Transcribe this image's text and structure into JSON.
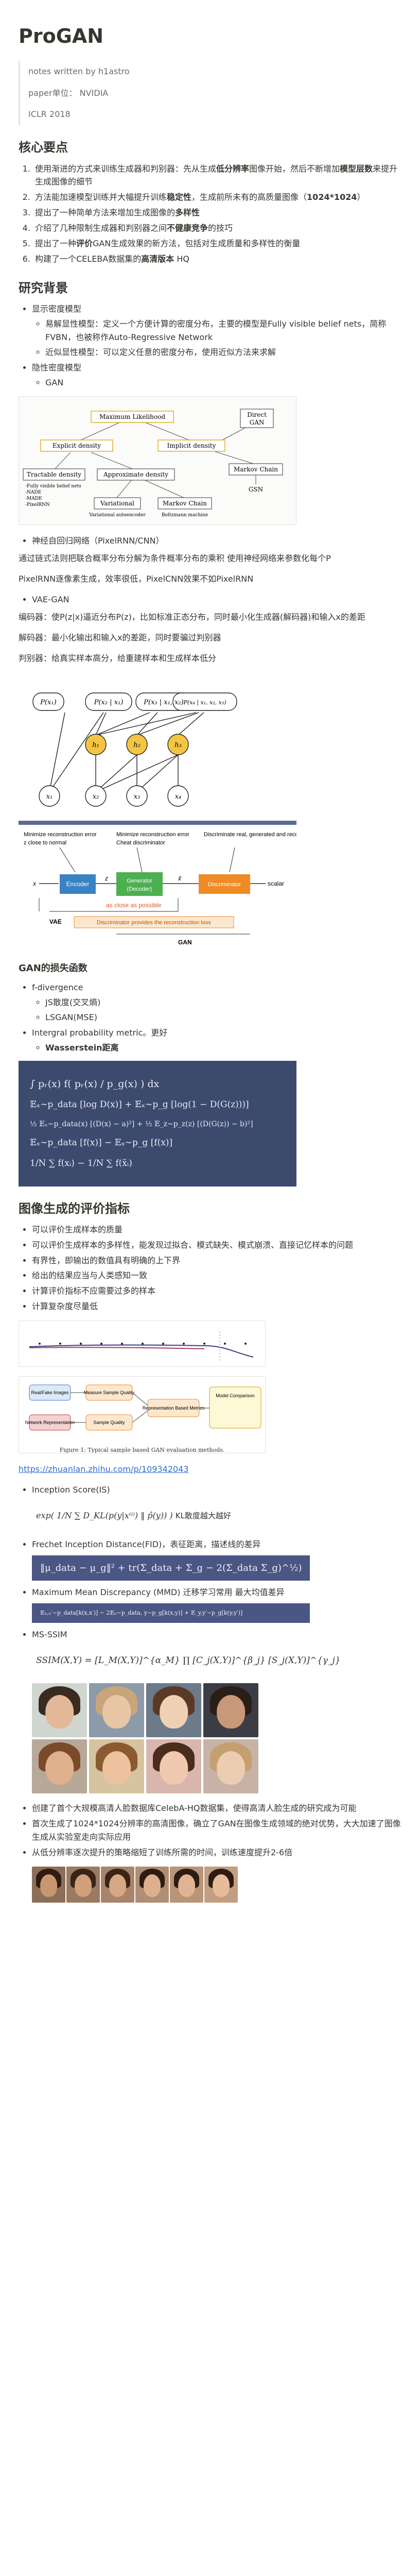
{
  "title": "ProGAN",
  "meta": {
    "notes": "notes written by h1astro",
    "paper_unit": "paper单位： NVIDIA",
    "venue": "ICLR 2018"
  },
  "key_points": {
    "heading": "核心要点",
    "items": [
      {
        "a": "使用渐进的方式来训练生成器和判别器：先从生成",
        "b": "低分辨率",
        "c": "图像开始，然后不断增加",
        "d": "模型层数",
        "e": "来提升生成图像的细节"
      },
      {
        "a": "方法能加速模型训练并大幅提升训练",
        "b": "稳定性",
        "c": "，生成前所未有的高质量图像（",
        "d": "1024*1024",
        "e": "）"
      },
      {
        "a": "提出了一种简单方法来增加生成图像的",
        "b": "多样性"
      },
      {
        "a": "介绍了几种限制生成器和判别器之间",
        "b": "不健康竞争",
        "c": "的技巧"
      },
      {
        "a": "提出了一种",
        "b": "评价",
        "c": "GAN生成效果的新方法，包括对生成质量和多样性的衡量"
      },
      {
        "a": "构建了一个CELEBA数据集的",
        "b": "高清版本",
        "c": " HQ"
      }
    ]
  },
  "background": {
    "heading": "研究背景",
    "explicit": "显示密度模型",
    "explicit_items": [
      "易解显性模型：定义一个方便计算的密度分布，主要的模型是Fully visible belief nets，简称FVBN，也被称作Auto-Regressive Network",
      "近似显性模型：可以定义任意的密度分布，使用近似方法来求解"
    ],
    "implicit": "隐性密度模型",
    "implicit_items": [
      "GAN"
    ],
    "taxonomy": {
      "root": "Maximum Likelihood",
      "explicit": "Explicit density",
      "implicit": "Implicit density",
      "direct": "Direct",
      "gan": "GAN",
      "tractable": "Tractable density",
      "tractable_sub": "-Fully visible belief nets\n-NADE\n-MADE\n-PixelRNN\n-Change of variables models\n(nonlinear ICA)",
      "approx": "Approximate density",
      "markov_implicit": "Markov Chain",
      "gsn": "GSN",
      "variational": "Variational",
      "vae": "Variational autoencoder",
      "markov_explicit": "Markov Chain",
      "boltzmann": "Boltzmann machine"
    },
    "pixelrnn_bullet": "神经自回归网络（PixelRNN/CNN）",
    "pixelrnn_p1": "通过链式法则把联合概率分布分解为条件概率分布的乘积 使用神经网络来参数化每个P",
    "pixelrnn_p2": "PixelRNN逐像素生成，效率很低，PixelCNN效果不如PixelRNN",
    "vae_bullet": "VAE-GAN",
    "vae_p1": "编码器：使P(z|x)逼近分布P(z)，比如标准正态分布，同时最小化生成器(解码器)和输入x的差距",
    "vae_p2": "解码器：最小化输出和输入x的差距，同时要骗过判别器",
    "vae_p3": "判别器：给真实样本高分，给重建样本和生成样本低分",
    "graph_nodes": {
      "p1": "P(x₁)",
      "p2": "P(x₂ | x₁)",
      "p3": "P(x₃ | x₁, x₂)",
      "p4": "P(x₄ | x₁, x₂, x₃)",
      "h1": "h₁",
      "h2": "h₂",
      "h3": "h₃",
      "x1": "x₁",
      "x2": "x₂",
      "x3": "x₃",
      "x4": "x₄"
    },
    "vaegan": {
      "c1": "Minimize reconstruction error",
      "c1b": "z close to normal",
      "c2": "Minimize reconstruction error",
      "c2b": "Cheat discriminator",
      "c3": "Discriminate real, generated and reconstructed images",
      "x": "x",
      "encoder": "Encoder",
      "z": "z",
      "generator": "Generator (Decoder)",
      "xtilde": "x̃",
      "discriminator": "Discriminator",
      "scalar": "scalar",
      "close": "as close as possible",
      "vae": "VAE",
      "gan": "GAN",
      "note": "Discriminator provides the reconstruction loss"
    }
  },
  "loss": {
    "heading": "GAN的损失函数",
    "fdiv": "f-divergence",
    "fdiv_items": [
      "JS散度(交叉熵)",
      "LSGAN(MSE)"
    ],
    "ipm": "Intergral probability metric。更好",
    "wass": "Wasserstein距离",
    "formulas": [
      "∫ pᵣ(x) f( pᵣ(x) / p_g(x) ) dx",
      "𝔼ₓ∼p_data [log D(x)] + 𝔼ₓ∼p_g [log(1 − D(G(z)))]",
      "½ 𝔼ₓ∼p_data(x) [(D(x) − a)²] + ½ 𝔼_z∼p_z(z) [(D(G(z)) − b)²]",
      "𝔼ₓ∼p_data [f(x)] − 𝔼ₓ∼p_g [f(x)]",
      "1/N ∑ f(xᵢ) − 1/N ∑ f(x̃ᵢ)"
    ]
  },
  "eval": {
    "heading": "图像生成的评价指标",
    "items": [
      "可以评价生成样本的质量",
      "可以评价生成样本的多样性，能发现过拟合、模式缺失、模式崩溃、直接记忆样本的问题",
      "有界性，即输出的数值具有明确的上下界",
      "给出的结果应当与人类感知一致",
      "计算评价指标不应需要过多的样本",
      "计算复杂度尽量低"
    ],
    "flow_boxes": [
      "Real/Fake Images",
      "Measure Sample Quality",
      "Network Representation",
      "Sample Quality",
      "Representation Based Metrics",
      "Model Comparison"
    ],
    "caption": "Figure 1: Typical sample based GAN evaluation methods.",
    "link": "https://zhuanlan.zhihu.com/p/109342043",
    "is_bullet": "Inception Score(IS)",
    "is_formula": "exp( 1/N ∑ D_KL(p(y|x⁽ⁱ⁾) ‖ p̂(y)) )",
    "is_note": "KL散度越大越好",
    "fid_bullet": "Frechet Inception Distance(FID)，表征距离，描述线的差异",
    "fid_formula": "‖μ_data − μ_g‖² + tr(Σ_data + Σ_g − 2(Σ_data Σ_g)^½)",
    "mmd_bullet": "Maximum Mean Discrepancy (MMD) 迁移学习常用 最大均值差异",
    "mmd_formula": "𝔼ₓ,ₓ′∼p_data[k(x,x′)] − 2𝔼ₓ∼p_data, y∼p_g[k(x,y)] + 𝔼_y,y′∼p_g[k(y,y′)]",
    "msssim_bullet": "MS-SSIM",
    "msssim_formula": "SSIM(X,Y) = [L_M(X,Y)]^{α_M} ∏ [C_j(X,Y)]^{β_j} [S_j(X,Y)]^{γ_j}"
  },
  "dataset": {
    "items": [
      "创建了首个大规模高清人脸数据库CelebA-HQ数据集，使得高清人脸生成的研究成为可能",
      "首次生成了1024*1024分辨率的高清图像，确立了GAN在图像生成领域的绝对优势，大大加速了图像生成从实验室走向实际应用",
      "从低分辨率逐次提升的策略缩短了训练所需的时间，训练速度提升2-6倍"
    ],
    "highlight": "1024*1024",
    "highlight2": "绝对优势"
  },
  "colors": {
    "text": "#37352f",
    "muted": "#6b6b6b",
    "accent_yellow": "#f4c542",
    "encoder_blue": "#3b82c4",
    "generator_green": "#4caf50",
    "discriminator_orange": "#f08a24",
    "formula_dark": "#3c4a6e"
  }
}
